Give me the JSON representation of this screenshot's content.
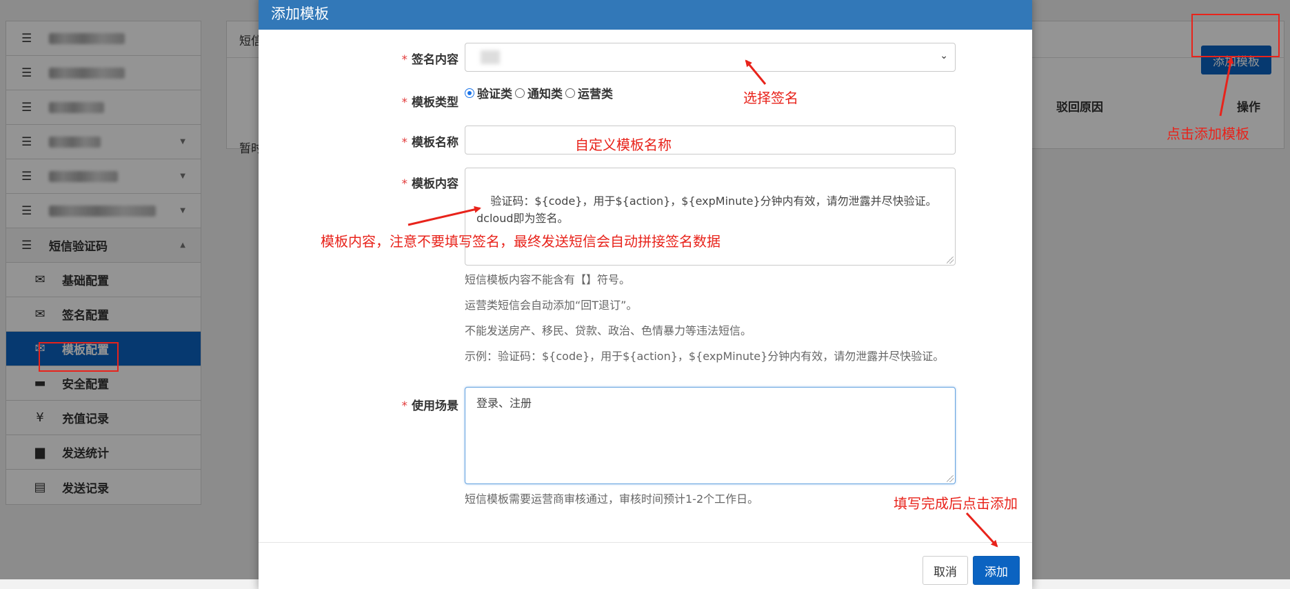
{
  "sidebar": {
    "items": [
      {
        "label": "",
        "blurred": true
      },
      {
        "label": "",
        "blurred": true
      },
      {
        "label": "",
        "blurred": true
      },
      {
        "label": "",
        "blurred": true,
        "has_caret": true
      },
      {
        "label": "",
        "blurred": true,
        "has_caret": true
      },
      {
        "label": "",
        "blurred": true,
        "has_caret": true
      }
    ],
    "group_label": "短信验证码",
    "sub_items": [
      {
        "label": "基础配置",
        "icon": "envelope-icon"
      },
      {
        "label": "签名配置",
        "icon": "envelope-icon"
      },
      {
        "label": "模板配置",
        "icon": "envelope-icon",
        "active": true
      },
      {
        "label": "安全配置",
        "icon": "briefcase-icon"
      },
      {
        "label": "充值记录",
        "icon": "yen-icon"
      },
      {
        "label": "发送统计",
        "icon": "bar-chart-icon"
      },
      {
        "label": "发送记录",
        "icon": "list-icon"
      }
    ]
  },
  "background": {
    "panel_title": "短信",
    "columns": [
      "驳回原因",
      "操作"
    ],
    "empty_text": "暂时",
    "add_template_button": "添加模板"
  },
  "modal": {
    "title": "添加模板",
    "fields": {
      "signature": {
        "label": "签名内容",
        "value": ""
      },
      "type": {
        "label": "模板类型",
        "options": [
          "验证类",
          "通知类",
          "运营类"
        ],
        "selected": "验证类"
      },
      "name": {
        "label": "模板名称",
        "value": ""
      },
      "content": {
        "label": "模板内容",
        "value": "验证码：${code}，用于${action}，${expMinute}分钟内有效，请勿泄露并尽快验证。\ndcloud即为签名。"
      },
      "scene": {
        "label": "使用场景",
        "value": "登录、注册"
      }
    },
    "help": [
      "短信模板内容不能含有【】符号。",
      "运营类短信会自动添加“回T退订”。",
      "不能发送房产、移民、贷款、政治、色情暴力等违法短信。",
      "示例：验证码：${code}，用于${action}，${expMinute}分钟内有效，请勿泄露并尽快验证。"
    ],
    "scene_help": "短信模板需要运营商审核通过，审核时间预计1-2个工作日。",
    "cancel_label": "取消",
    "submit_label": "添加"
  },
  "annotations": {
    "select_signature": "选择签名",
    "custom_name": "自定义模板名称",
    "content_note": "模板内容，注意不要填写签名，最终发送短信会自动拼接签名数据",
    "click_add_template": "点击添加模板",
    "click_add_done": "填写完成后点击添加"
  },
  "colors": {
    "primary": "#0b63c1",
    "modal_header": "#3278b8",
    "annotation": "#e8231b",
    "required": "#e23a3a"
  }
}
